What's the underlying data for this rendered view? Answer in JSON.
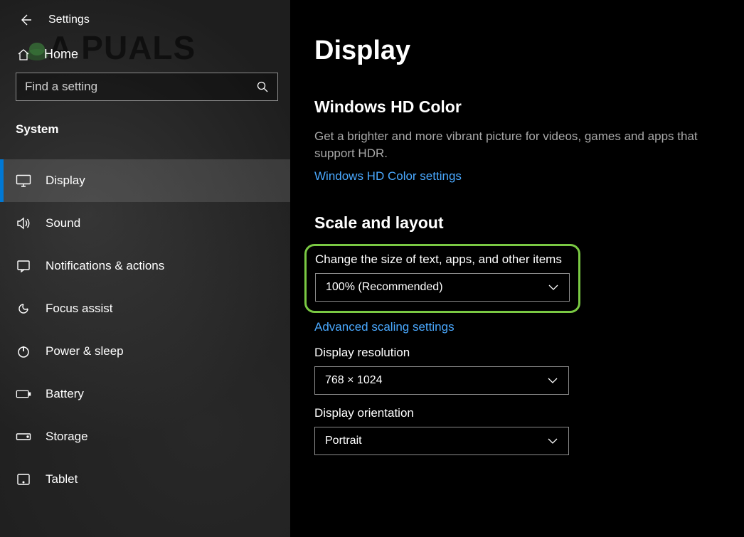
{
  "header": {
    "settings_title": "Settings",
    "home_label": "Home",
    "search_placeholder": "Find a setting",
    "category_label": "System"
  },
  "sidebar": {
    "items": [
      {
        "label": "Display",
        "icon": "display"
      },
      {
        "label": "Sound",
        "icon": "sound"
      },
      {
        "label": "Notifications & actions",
        "icon": "notifications"
      },
      {
        "label": "Focus assist",
        "icon": "focus"
      },
      {
        "label": "Power & sleep",
        "icon": "power"
      },
      {
        "label": "Battery",
        "icon": "battery"
      },
      {
        "label": "Storage",
        "icon": "storage"
      },
      {
        "label": "Tablet",
        "icon": "tablet"
      }
    ]
  },
  "main": {
    "title": "Display",
    "hdcolor": {
      "heading": "Windows HD Color",
      "desc": "Get a brighter and more vibrant picture for videos, games and apps that support HDR.",
      "link": "Windows HD Color settings"
    },
    "scale": {
      "heading": "Scale and layout",
      "textsize_label": "Change the size of text, apps, and other items",
      "textsize_value": "100% (Recommended)",
      "advanced_link": "Advanced scaling settings",
      "resolution_label": "Display resolution",
      "resolution_value": "768 × 1024",
      "orientation_label": "Display orientation",
      "orientation_value": "Portrait"
    }
  },
  "watermark": "A   PUALS"
}
